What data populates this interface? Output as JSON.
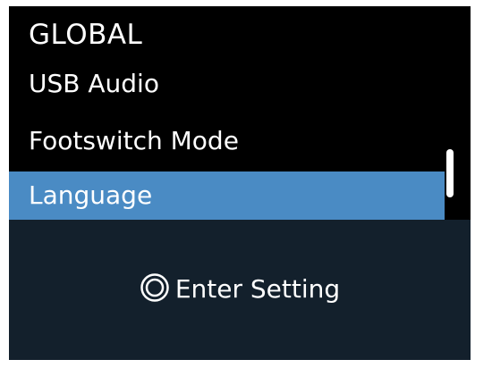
{
  "menu": {
    "title": "GLOBAL",
    "items": [
      {
        "label": "USB Audio",
        "selected": false
      },
      {
        "label": "Footswitch Mode",
        "selected": false
      },
      {
        "label": "Language",
        "selected": true
      }
    ]
  },
  "footer": {
    "icon": "knob-icon",
    "action_label": "Enter Setting"
  },
  "colors": {
    "background": "#000000",
    "selection": "#4a8bc4",
    "footer_background": "#13202c",
    "text": "#ffffff"
  }
}
